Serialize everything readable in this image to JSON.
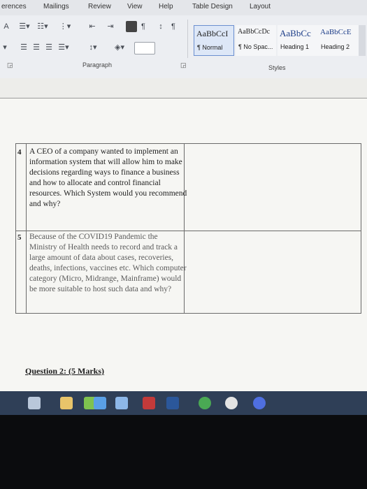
{
  "ribbon": {
    "tabs": [
      "erences",
      "Mailings",
      "Review",
      "View",
      "Help",
      "Table Design",
      "Layout"
    ],
    "groups": {
      "paragraph": "Paragraph",
      "styles": "Styles"
    },
    "styles": [
      {
        "sample": "AaBbCcI",
        "name": "¶ Normal"
      },
      {
        "sample": "AaBbCcDc",
        "name": "¶ No Spac..."
      },
      {
        "sample": "AaBbCc",
        "name": "Heading 1"
      },
      {
        "sample": "AaBbCcE",
        "name": "Heading 2"
      }
    ]
  },
  "table": {
    "rows": [
      {
        "number": "4",
        "question": "A CEO of a company wanted to implement an information system that will allow him to make decisions regarding ways to finance a business and how to allocate and control financial resources. Which System would you recommend and why?"
      },
      {
        "number": "5",
        "question": "Because of the COVID19 Pandemic the Ministry of Health needs to record and track a large amount of data about cases, recoveries, deaths, infections, vaccines etc. Which computer category (Micro, Midrange, Mainframe) would be more suitable to host such data and why?"
      }
    ]
  },
  "question_heading": "Question 2: (5 Marks)",
  "taskbar": {
    "icons": [
      "task-view-icon",
      "file-explorer-icon",
      "calculator-icon",
      "store-icon",
      "mail-icon",
      "onenote-icon",
      "word-icon",
      "chrome-icon",
      "edge-icon",
      "cortana-icon"
    ],
    "colors": [
      "#b9c7da",
      "#e8c46a",
      "#7fc24f",
      "#5aa0e6",
      "#8db7e8",
      "#c23a3a",
      "#2b579a",
      "#4aa854",
      "#e3e3e3",
      "#4f6fe0"
    ]
  }
}
